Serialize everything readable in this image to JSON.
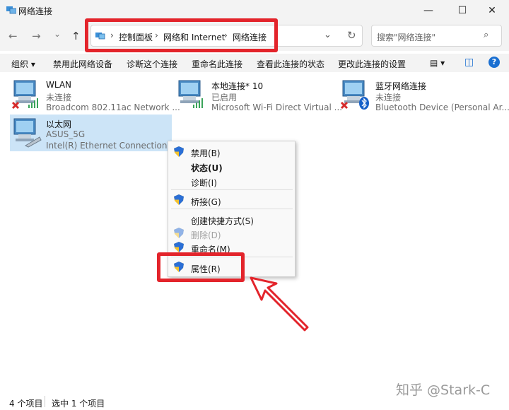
{
  "window": {
    "title": "网络连接",
    "minimize": "—",
    "maximize": "☐",
    "close": "✕"
  },
  "nav": {
    "back": "←",
    "forward": "→",
    "recent": "⌄",
    "up": "↑"
  },
  "breadcrumb": {
    "items": [
      "控制面板",
      "网络和 Internet",
      "网络连接"
    ],
    "separator": "›",
    "dropdown": "⌄",
    "refresh": "↻"
  },
  "search": {
    "placeholder": "搜索\"网络连接\"",
    "icon": "⌕"
  },
  "toolbar": {
    "organize": "组织 ▾",
    "disable": "禁用此网络设备",
    "diagnose": "诊断这个连接",
    "rename": "重命名此连接",
    "view_status": "查看此连接的状态",
    "change_settings": "更改此连接的设置",
    "view_icon": "▤ ▾",
    "pane_icon": "◫",
    "help": "?"
  },
  "connections": [
    {
      "name": "WLAN",
      "status": "未连接",
      "device": "Broadcom 802.11ac Network ..."
    },
    {
      "name": "本地连接* 10",
      "status": "已启用",
      "device": "Microsoft Wi-Fi Direct Virtual ..."
    },
    {
      "name": "蓝牙网络连接",
      "status": "未连接",
      "device": "Bluetooth Device (Personal Ar..."
    },
    {
      "name": "以太网",
      "status": "ASUS_5G",
      "device": "Intel(R) Ethernet Connection (..."
    }
  ],
  "context_menu": {
    "items": [
      "禁用(B)",
      "状态(U)",
      "诊断(I)",
      "桥接(G)",
      "创建快捷方式(S)",
      "删除(D)",
      "重命名(M)",
      "属性(R)"
    ]
  },
  "statusbar": {
    "count": "4 个项目",
    "selected": "选中 1 个项目"
  },
  "watermark": "知乎 @Stark-C",
  "colors": {
    "highlight": "#e3242b",
    "selection": "#cce4f7"
  }
}
